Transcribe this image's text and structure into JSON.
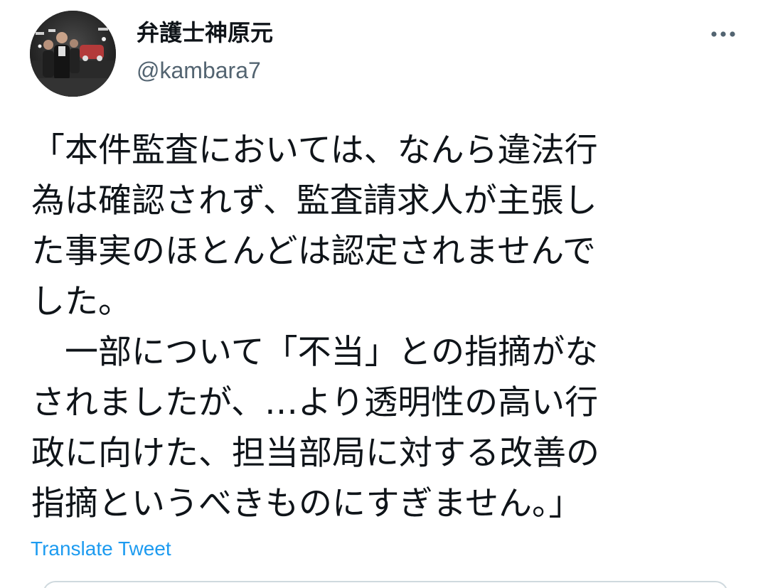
{
  "author": {
    "display_name": "弁護士神原元",
    "handle": "@kambara7"
  },
  "tweet": {
    "lines": [
      "「本件監査においては、なんら違法行",
      "為は確認されず、監査請求人が主張し",
      "た事実のほとんどは認定されませんで",
      "した。",
      "　一部について「不当」との指摘がな",
      "されましたが、…より透明性の高い行",
      "政に向けた、担当部局に対する改善の",
      "指摘というべきものにすぎません。」"
    ],
    "translate_label": "Translate Tweet"
  },
  "icons": {
    "more": "more-horizontal-icon",
    "avatar": "profile-photo"
  },
  "colors": {
    "text": "#0f1419",
    "secondary": "#536471",
    "link": "#1d9bf0"
  }
}
